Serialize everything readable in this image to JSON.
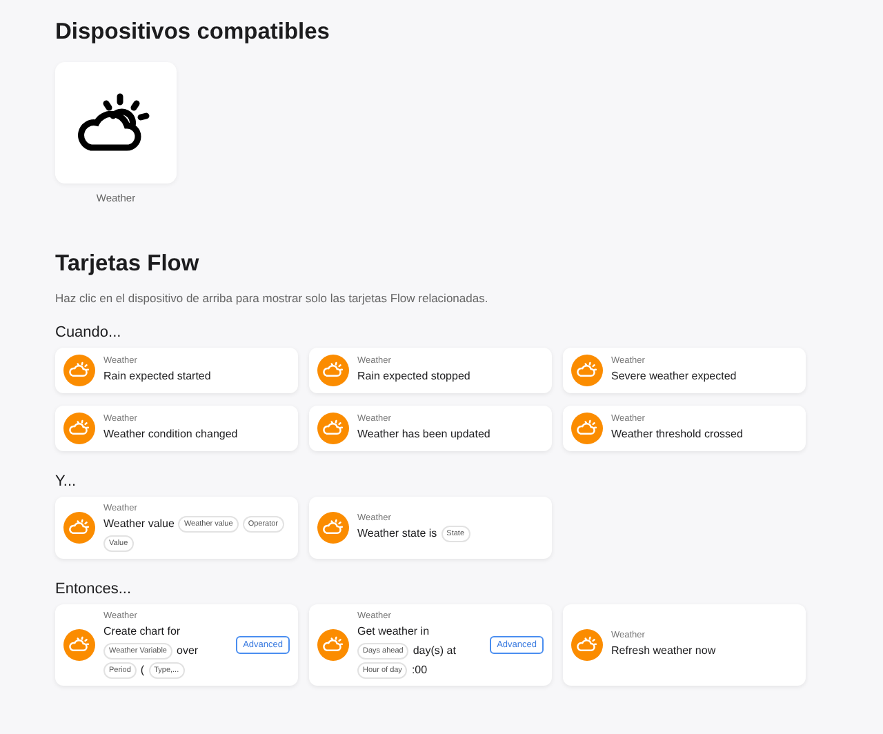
{
  "devices_title": "Dispositivos compatibles",
  "devices": [
    {
      "name": "Weather"
    }
  ],
  "flow_title": "Tarjetas Flow",
  "flow_hint": "Haz clic en el dispositivo de arriba para mostrar solo las tarjetas Flow relacionadas.",
  "sections": [
    {
      "title": "Cuando...",
      "cards": [
        {
          "device": "Weather",
          "parts": [
            {
              "kind": "text",
              "text": "Rain expected started"
            }
          ]
        },
        {
          "device": "Weather",
          "parts": [
            {
              "kind": "text",
              "text": "Rain expected stopped"
            }
          ]
        },
        {
          "device": "Weather",
          "parts": [
            {
              "kind": "text",
              "text": "Severe weather expected"
            }
          ]
        },
        {
          "device": "Weather",
          "parts": [
            {
              "kind": "text",
              "text": "Weather condition changed"
            }
          ]
        },
        {
          "device": "Weather",
          "parts": [
            {
              "kind": "text",
              "text": "Weather has been updated"
            }
          ]
        },
        {
          "device": "Weather",
          "parts": [
            {
              "kind": "text",
              "text": "Weather threshold crossed"
            }
          ]
        }
      ]
    },
    {
      "title": "Y...",
      "cards": [
        {
          "device": "Weather",
          "parts": [
            {
              "kind": "text",
              "text": "Weather value"
            },
            {
              "kind": "arg",
              "text": "Weather value"
            },
            {
              "kind": "arg",
              "text": "Operator"
            },
            {
              "kind": "arg",
              "text": "Value"
            }
          ]
        },
        {
          "device": "Weather",
          "parts": [
            {
              "kind": "text",
              "text": "Weather state is"
            },
            {
              "kind": "arg",
              "text": "State"
            }
          ]
        }
      ]
    },
    {
      "title": "Entonces...",
      "cards": [
        {
          "device": "Weather",
          "advanced": "Advanced",
          "parts": [
            {
              "kind": "text",
              "text": "Create chart for"
            },
            {
              "kind": "arg",
              "text": "Weather Variable"
            },
            {
              "kind": "text",
              "text": "over"
            },
            {
              "kind": "arg",
              "text": "Period"
            },
            {
              "kind": "text",
              "text": "("
            },
            {
              "kind": "arg",
              "text": "Type,..."
            }
          ]
        },
        {
          "device": "Weather",
          "advanced": "Advanced",
          "parts": [
            {
              "kind": "text",
              "text": "Get weather in"
            },
            {
              "kind": "arg",
              "text": "Days ahead"
            },
            {
              "kind": "text",
              "text": "day(s) at"
            },
            {
              "kind": "arg",
              "text": "Hour of day"
            },
            {
              "kind": "text",
              "text": ":00"
            }
          ]
        },
        {
          "device": "Weather",
          "parts": [
            {
              "kind": "text",
              "text": "Refresh weather now"
            }
          ]
        }
      ]
    }
  ]
}
